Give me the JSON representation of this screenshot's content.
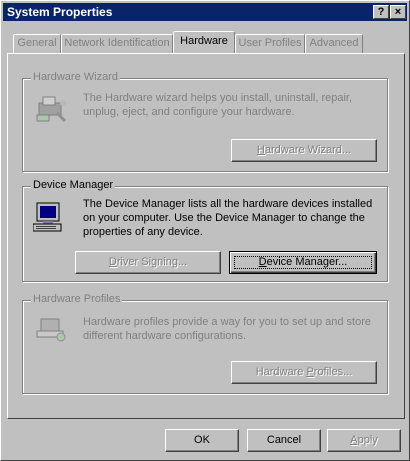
{
  "window": {
    "title": "System Properties",
    "help_btn": "?",
    "close_btn": "×"
  },
  "tabs": [
    {
      "label": "General"
    },
    {
      "label": "Network Identification"
    },
    {
      "label": "Hardware"
    },
    {
      "label": "User Profiles"
    },
    {
      "label": "Advanced"
    }
  ],
  "hardware_wizard": {
    "title": "Hardware Wizard",
    "line1": "The Hardware wizard helps you install, uninstall, repair,",
    "line2": "unplug, eject, and configure your hardware.",
    "button_pre": "",
    "button_u": "H",
    "button_post": "ardware Wizard..."
  },
  "device_manager": {
    "title": "Device Manager",
    "line1": "The Device Manager lists all the hardware devices installed",
    "line2": "on your computer. Use the Device Manager to change the",
    "line3": "properties of any device.",
    "signing_pre": "",
    "signing_u": "D",
    "signing_post": "river Signing...",
    "button_pre": "",
    "button_u": "D",
    "button_post": "evice Manager..."
  },
  "hardware_profiles": {
    "title": "Hardware Profiles",
    "line1": "Hardware profiles provide a way for you to set up and store",
    "line2": "different hardware configurations.",
    "button_pre": "Hardware ",
    "button_u": "P",
    "button_post": "rofiles..."
  },
  "footer": {
    "ok": "OK",
    "cancel": "Cancel",
    "apply_u": "A",
    "apply_post": "pply"
  },
  "icons": [
    "help-icon",
    "close-icon",
    "hardware-wizard-icon",
    "device-manager-icon",
    "hardware-profiles-icon"
  ]
}
